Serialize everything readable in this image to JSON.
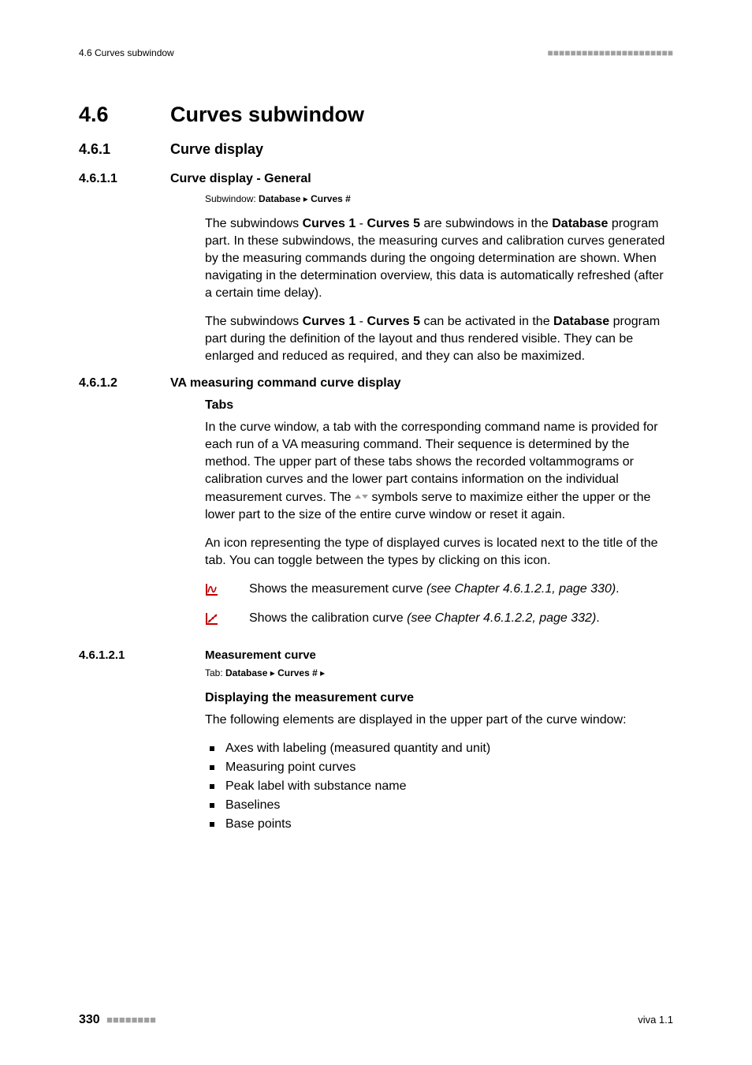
{
  "header": {
    "left": "4.6 Curves subwindow",
    "right_dashes": "■■■■■■■■■■■■■■■■■■■■■■"
  },
  "sec_4_6": {
    "num": "4.6",
    "title": "Curves subwindow"
  },
  "sec_4_6_1": {
    "num": "4.6.1",
    "title": "Curve display"
  },
  "sec_4_6_1_1": {
    "num": "4.6.1.1",
    "title": "Curve display - General",
    "crumb_label": "Subwindow: ",
    "crumb_a": "Database",
    "crumb_sep": " ▸ ",
    "crumb_b": "Curves #",
    "p1_a": "The subwindows ",
    "p1_b": "Curves 1",
    "p1_c": " - ",
    "p1_d": "Curves 5",
    "p1_e": " are subwindows in the ",
    "p1_f": "Database",
    "p1_g": " program part. In these subwindows, the measuring curves and calibration curves generated by the measuring commands during the ongoing determination are shown. When navigating in the determination overview, this data is automatically refreshed (after a certain time delay).",
    "p2_a": "The subwindows ",
    "p2_b": "Curves 1",
    "p2_c": " - ",
    "p2_d": "Curves 5",
    "p2_e": " can be activated in the ",
    "p2_f": "Database",
    "p2_g": " program part during the definition of the layout and thus rendered visible. They can be enlarged and reduced as required, and they can also be maximized."
  },
  "sec_4_6_1_2": {
    "num": "4.6.1.2",
    "title": "VA measuring command curve display",
    "tabs_head": "Tabs",
    "tabs_p1_a": "In the curve window, a tab with the corresponding command name is provided for each run of a VA measuring command. Their sequence is determined by the method. The upper part of these tabs shows the recorded voltammograms or calibration curves and the lower part contains information on the individual measurement curves. The ",
    "tabs_p1_b": " symbols serve to maximize either the upper or the lower part to the size of the entire curve window or reset it again.",
    "tabs_p2": "An icon representing the type of displayed curves is located next to the title of the tab. You can toggle between the types by clicking on this icon.",
    "icon1_a": "Shows the measurement curve ",
    "icon1_b": "(see Chapter 4.6.1.2.1, page 330)",
    "icon1_c": ".",
    "icon2_a": "Shows the calibration curve ",
    "icon2_b": "(see Chapter 4.6.1.2.2, page 332)",
    "icon2_c": "."
  },
  "sec_4_6_1_2_1": {
    "num": "4.6.1.2.1",
    "title": "Measurement curve",
    "crumb_label": "Tab: ",
    "crumb_a": "Database",
    "crumb_sep1": " ▸ ",
    "crumb_b": "Curves #",
    "crumb_sep2": " ▸",
    "disp_head": "Displaying the measurement curve",
    "disp_intro": "The following elements are displayed in the upper part of the curve window:",
    "bullets": {
      "0": "Axes with labeling (measured quantity and unit)",
      "1": "Measuring point curves",
      "2": "Peak label with substance name",
      "3": "Baselines",
      "4": "Base points"
    }
  },
  "footer": {
    "page": "330",
    "page_dashes": "■■■■■■■■",
    "doc": "viva 1.1"
  }
}
